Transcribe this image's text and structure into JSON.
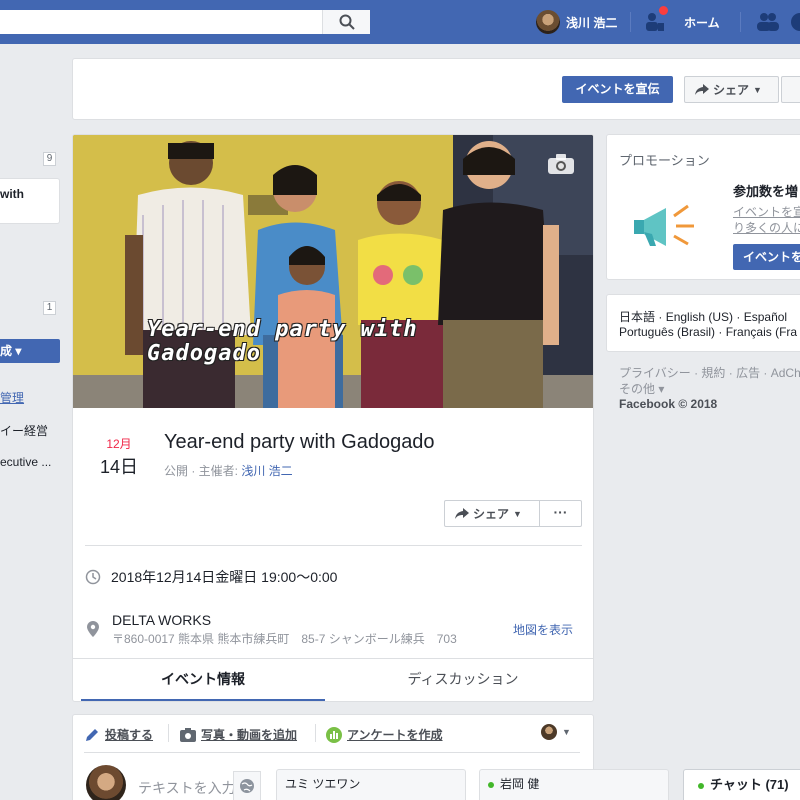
{
  "topbar": {
    "user_name": "浅川 浩二",
    "home_label": "ホーム"
  },
  "left_sidebar": {
    "count_1": "9",
    "card_text": "with",
    "count_2": "1",
    "create_button": "成 ▾",
    "links": [
      "管理",
      "イー経営",
      "ecutive ..."
    ]
  },
  "header": {
    "promote_button": "イベントを宣伝",
    "share_button": "シェア"
  },
  "event": {
    "cover_title": "Year-end party with Gadogado",
    "month": "12月",
    "day": "14日",
    "title": "Year-end party with Gadogado",
    "visibility_prefix": "公開 · 主催者: ",
    "host": "浅川 浩二",
    "share_button": "シェア",
    "more_button": "···",
    "datetime": "2018年12月14日金曜日 19:00〜0:00",
    "location_name": "DELTA WORKS",
    "location_address": "〒860-0017 熊本県 熊本市練兵町　85-7 シャンボール練兵　703",
    "map_link": "地図を表示",
    "tabs": [
      "イベント情報",
      "ディスカッション"
    ]
  },
  "composer": {
    "post": "投稿する",
    "photo": "写真・動画を追加",
    "poll": "アンケートを作成",
    "placeholder": "テキストを入力"
  },
  "promotion": {
    "title": "プロモーション",
    "heading": "参加数を増",
    "desc_line1": "イベントを宣",
    "desc_line2": "り多くの人に",
    "button": "イベントを"
  },
  "languages": {
    "row1": [
      "日本語",
      "English (US)",
      "Español"
    ],
    "row2": [
      "Português (Brasil)",
      "Français (Fra"
    ]
  },
  "footer": {
    "line1": "プライバシー · 規約 · 広告 · AdCh",
    "line2": "その他 ▾",
    "copyright": "Facebook © 2018"
  },
  "chat": {
    "contact1": "ユミ ツエワン",
    "contact2": "岩岡 健",
    "main": "チャット (71)"
  },
  "colors": {
    "brand": "#4267b2",
    "background": "#e9ebee",
    "date_red": "#f02849",
    "online": "#42b72a"
  }
}
